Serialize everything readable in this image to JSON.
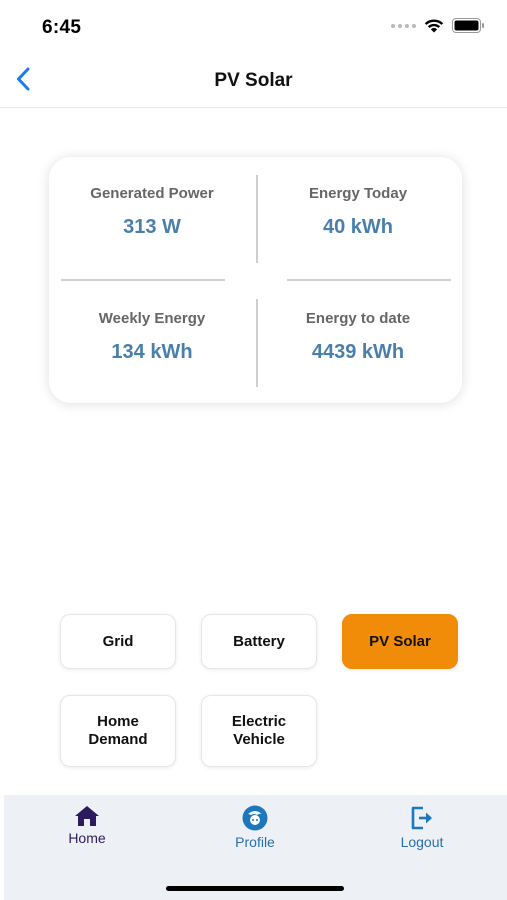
{
  "status_bar": {
    "time": "6:45"
  },
  "nav": {
    "title": "PV Solar",
    "back_icon": "chevron-left-icon"
  },
  "stats": {
    "generated_power": {
      "label": "Generated Power",
      "value": "313 W"
    },
    "energy_today": {
      "label": "Energy Today",
      "value": "40 kWh"
    },
    "weekly_energy": {
      "label": "Weekly Energy",
      "value": "134 kWh"
    },
    "energy_to_date": {
      "label": "Energy to date",
      "value": "4439 kWh"
    },
    "value_color": "#4a7fac"
  },
  "sources": {
    "active": "PV Solar",
    "active_color": "#f18c09",
    "grid": "Grid",
    "battery": "Battery",
    "pv_solar": "PV Solar",
    "home_demand": "Home\nDemand",
    "electric_vehicle": "Electric\nVehicle"
  },
  "tab_bar": {
    "home": {
      "label": "Home",
      "icon": "home-icon",
      "color": "#2d1a5e"
    },
    "profile": {
      "label": "Profile",
      "icon": "profile-icon",
      "color": "#2a6fad"
    },
    "logout": {
      "label": "Logout",
      "icon": "logout-icon",
      "color": "#2a6fad"
    }
  }
}
